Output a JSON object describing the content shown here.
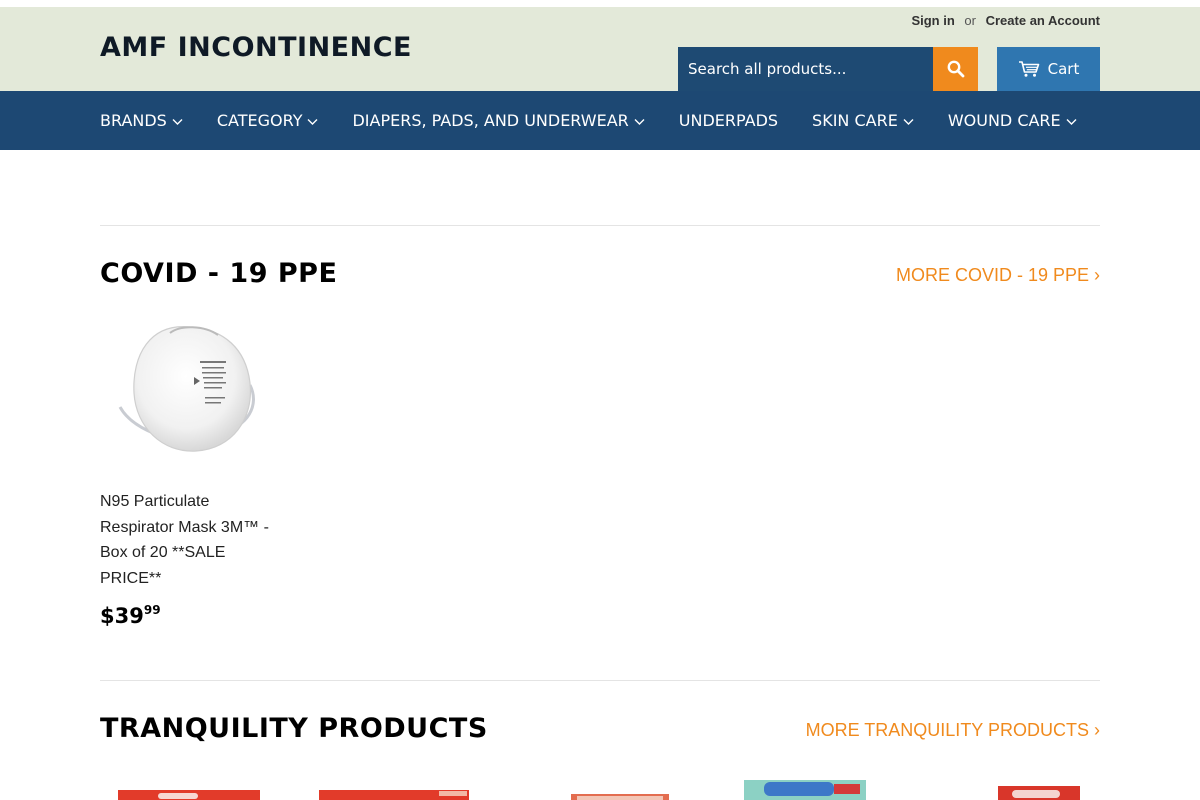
{
  "header": {
    "site_title": "AMF INCONTINENCE",
    "sign_in": "Sign in",
    "or": "or",
    "create_account": "Create an Account",
    "search_placeholder": "Search all products...",
    "cart_label": "Cart"
  },
  "nav": {
    "items": [
      {
        "label": "BRANDS",
        "dropdown": true
      },
      {
        "label": "CATEGORY",
        "dropdown": true
      },
      {
        "label": "DIAPERS, PADS, AND UNDERWEAR",
        "dropdown": true
      },
      {
        "label": "UNDERPADS",
        "dropdown": false
      },
      {
        "label": "SKIN CARE",
        "dropdown": true
      },
      {
        "label": "WOUND CARE",
        "dropdown": true
      }
    ]
  },
  "sections": [
    {
      "title": "COVID - 19 PPE",
      "more_link": "MORE COVID - 19 PPE ›",
      "products": [
        {
          "name": "N95 Particulate Respirator Mask 3M™ - Box of 20 **SALE PRICE**",
          "price_main": "$39",
          "price_cents": "99"
        }
      ]
    },
    {
      "title": "TRANQUILITY PRODUCTS",
      "more_link": "MORE TRANQUILITY PRODUCTS ›"
    }
  ],
  "colors": {
    "header_bg": "#e3e9d9",
    "nav_bg": "#1d4873",
    "accent_orange": "#f08a1d",
    "cart_blue": "#2f76b0"
  }
}
